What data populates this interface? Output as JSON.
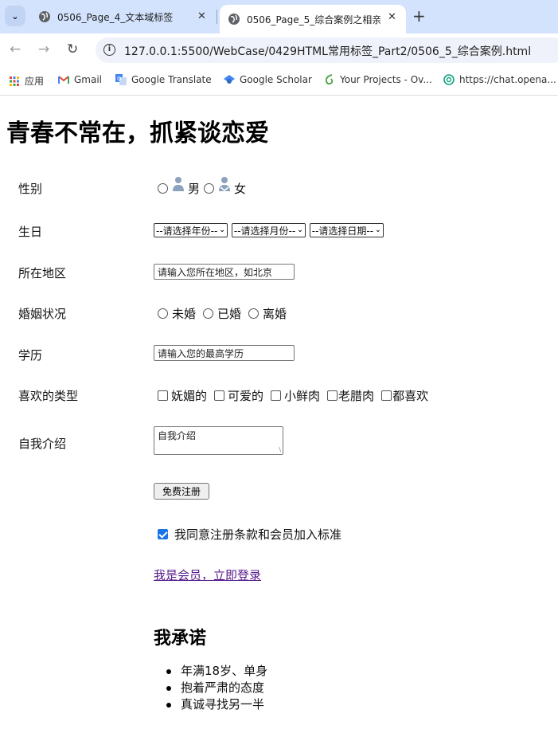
{
  "browser": {
    "tabs": [
      {
        "title": "0506_Page_4_文本域标签",
        "active": false
      },
      {
        "title": "0506_Page_5_综合案例之相亲",
        "active": true
      }
    ],
    "url": "127.0.0.1:5500/WebCase/0429HTML常用标签_Part2/0506_5_综合案例.html",
    "bookmarks": [
      {
        "label": "应用",
        "icon": "apps-grid-icon"
      },
      {
        "label": "Gmail",
        "icon": "gmail-icon"
      },
      {
        "label": "Google Translate",
        "icon": "translate-icon"
      },
      {
        "label": "Google Scholar",
        "icon": "scholar-icon"
      },
      {
        "label": "Your Projects - Ov...",
        "icon": "overleaf-icon"
      },
      {
        "label": "https://chat.opena...",
        "icon": "openai-icon"
      }
    ]
  },
  "page": {
    "title": "青春不常在，抓紧谈恋爱",
    "gender": {
      "label": "性别",
      "options": [
        "男",
        "女"
      ]
    },
    "birthday": {
      "label": "生日",
      "year_placeholder": "--请选择年份--",
      "month_placeholder": "--请选择月份--",
      "day_placeholder": "--请选择日期--"
    },
    "region": {
      "label": "所在地区",
      "placeholder": "请输入您所在地区，如北京"
    },
    "marital": {
      "label": "婚姻状况",
      "options": [
        "未婚",
        "已婚",
        "离婚"
      ]
    },
    "education": {
      "label": "学历",
      "placeholder": "请输入您的最高学历"
    },
    "preferences": {
      "label": "喜欢的类型",
      "options": [
        "妩媚的",
        "可爱的",
        "小鲜肉",
        "老腊肉",
        "都喜欢"
      ]
    },
    "intro": {
      "label": "自我介绍",
      "placeholder": "自我介绍"
    },
    "submit_label": "免费注册",
    "agree": {
      "label": "我同意注册条款和会员加入标准",
      "checked": true
    },
    "login_link": "我是会员，立即登录",
    "promise": {
      "heading": "我承诺",
      "items": [
        "年满18岁、单身",
        "抱着严肃的态度",
        "真诚寻找另一半"
      ]
    }
  }
}
